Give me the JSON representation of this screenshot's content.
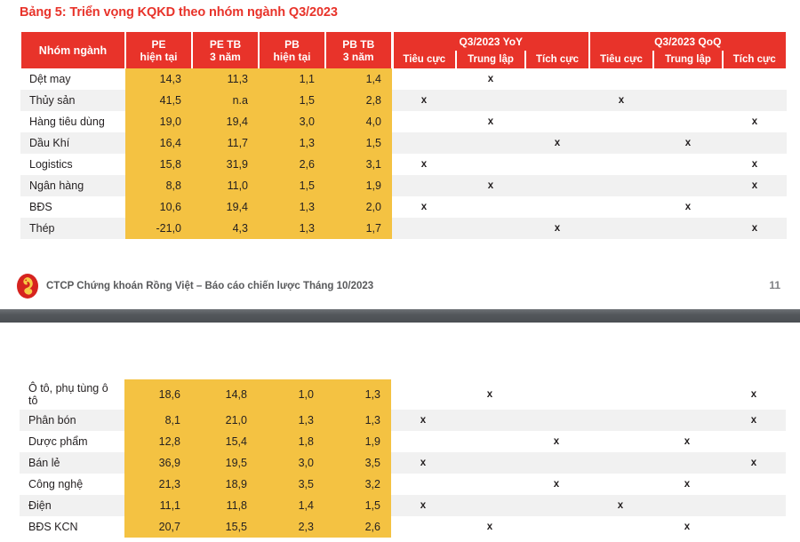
{
  "document": {
    "title": "Bảng 5: Triển vọng KQKD theo nhóm ngành Q3/2023",
    "accent_color": "#e8332a",
    "highlight_color": "#f4c242",
    "footer_text": "CTCP Chứng khoán Rồng Việt – Báo cáo chiến lược Tháng 10/2023",
    "page_number": "11",
    "logo_name": "rong-viet-logo"
  },
  "table": {
    "headers": {
      "name": "Nhóm ngành",
      "pe_current": "PE\nhiện tại",
      "pe_current_l1": "PE",
      "pe_current_l2": "hiện tại",
      "pe_avg3y_l1": "PE TB",
      "pe_avg3y_l2": "3 năm",
      "pb_current_l1": "PB",
      "pb_current_l2": "hiện tại",
      "pb_avg3y_l1": "PB TB",
      "pb_avg3y_l2": "3 năm",
      "group_yoy": "Q3/2023 YoY",
      "group_qoq": "Q3/2023 QoQ",
      "negative": "Tiêu cực",
      "neutral": "Trung lập",
      "positive": "Tích cực"
    },
    "mark": "x",
    "rows_page1": [
      {
        "name": "Dệt may",
        "pe": "14,3",
        "pe_tb": "11,3",
        "pb": "1,1",
        "pb_tb": "1,4",
        "yoy": "neutral",
        "qoq": ""
      },
      {
        "name": "Thủy sản",
        "pe": "41,5",
        "pe_tb": "n.a",
        "pb": "1,5",
        "pb_tb": "2,8",
        "yoy": "negative",
        "qoq": "negative"
      },
      {
        "name": "Hàng tiêu dùng",
        "pe": "19,0",
        "pe_tb": "19,4",
        "pb": "3,0",
        "pb_tb": "4,0",
        "yoy": "neutral",
        "qoq": "positive"
      },
      {
        "name": "Dầu Khí",
        "pe": "16,4",
        "pe_tb": "11,7",
        "pb": "1,3",
        "pb_tb": "1,5",
        "yoy": "positive",
        "qoq": "neutral"
      },
      {
        "name": "Logistics",
        "pe": "15,8",
        "pe_tb": "31,9",
        "pb": "2,6",
        "pb_tb": "3,1",
        "yoy": "negative",
        "qoq": "positive"
      },
      {
        "name": "Ngân hàng",
        "pe": "8,8",
        "pe_tb": "11,0",
        "pb": "1,5",
        "pb_tb": "1,9",
        "yoy": "neutral",
        "qoq": "positive"
      },
      {
        "name": "BĐS",
        "pe": "10,6",
        "pe_tb": "19,4",
        "pb": "1,3",
        "pb_tb": "2,0",
        "yoy": "negative",
        "qoq": "neutral"
      },
      {
        "name": "Thép",
        "pe": "-21,0",
        "pe_tb": "4,3",
        "pb": "1,3",
        "pb_tb": "1,7",
        "yoy": "positive",
        "qoq": "positive"
      }
    ],
    "rows_page2": [
      {
        "name": "Ô tô, phụ tùng ô tô",
        "pe": "18,6",
        "pe_tb": "14,8",
        "pb": "1,0",
        "pb_tb": "1,3",
        "yoy": "neutral",
        "qoq": "positive",
        "tall": true
      },
      {
        "name": "Phân bón",
        "pe": "8,1",
        "pe_tb": "21,0",
        "pb": "1,3",
        "pb_tb": "1,3",
        "yoy": "negative",
        "qoq": "positive"
      },
      {
        "name": "Dược phẩm",
        "pe": "12,8",
        "pe_tb": "15,4",
        "pb": "1,8",
        "pb_tb": "1,9",
        "yoy": "positive",
        "qoq": "neutral"
      },
      {
        "name": "Bán lẻ",
        "pe": "36,9",
        "pe_tb": "19,5",
        "pb": "3,0",
        "pb_tb": "3,5",
        "yoy": "negative",
        "qoq": "positive"
      },
      {
        "name": "Công nghệ",
        "pe": "21,3",
        "pe_tb": "18,9",
        "pb": "3,5",
        "pb_tb": "3,2",
        "yoy": "positive",
        "qoq": "neutral"
      },
      {
        "name": "Điện",
        "pe": "11,1",
        "pe_tb": "11,8",
        "pb": "1,4",
        "pb_tb": "1,5",
        "yoy": "negative",
        "qoq": "negative"
      },
      {
        "name": "BĐS KCN",
        "pe": "20,7",
        "pe_tb": "15,5",
        "pb": "2,3",
        "pb_tb": "2,6",
        "yoy": "neutral",
        "qoq": "neutral"
      }
    ]
  }
}
